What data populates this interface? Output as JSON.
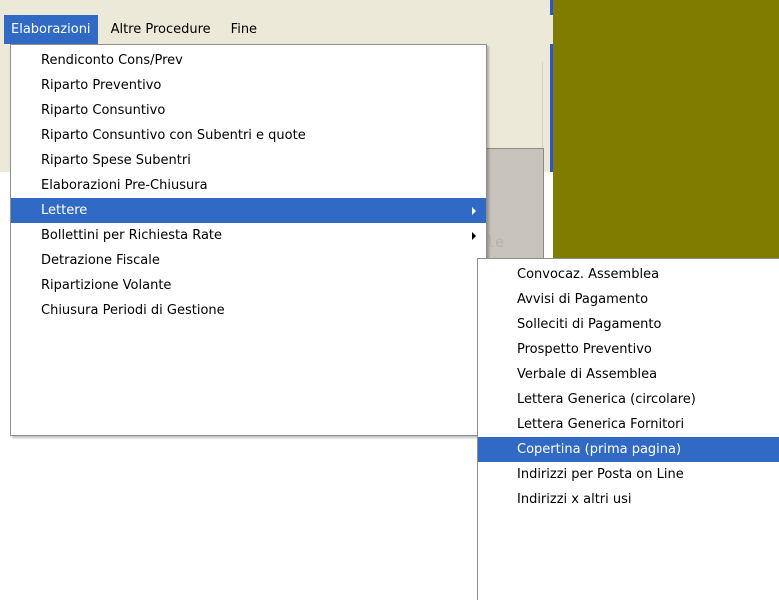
{
  "menubar": {
    "items": [
      "Elaborazioni",
      "Altre Procedure",
      "Fine"
    ]
  },
  "background": {
    "ghost_text": "le",
    "olive_color": "#807c00",
    "highlight_color": "#316ac5"
  },
  "main_menu": {
    "items": [
      {
        "label": "Rendiconto Cons/Prev"
      },
      {
        "label": "Riparto Preventivo"
      },
      {
        "label": "Riparto Consuntivo"
      },
      {
        "label": "Riparto Consuntivo con Subentri e quote"
      },
      {
        "label": "Riparto Spese Subentri"
      },
      {
        "label": "Elaborazioni Pre-Chiusura"
      },
      {
        "label": "Lettere",
        "submenu": true,
        "highlighted": true
      },
      {
        "label": "Bollettini per Richiesta Rate",
        "submenu": true
      },
      {
        "label": "Detrazione Fiscale"
      },
      {
        "label": "Ripartizione Volante"
      },
      {
        "label": "Chiusura Periodi di Gestione"
      }
    ]
  },
  "sub_menu": {
    "items": [
      {
        "label": "Convocaz. Assemblea"
      },
      {
        "label": "Avvisi di Pagamento"
      },
      {
        "label": "Solleciti di Pagamento"
      },
      {
        "label": "Prospetto Preventivo"
      },
      {
        "label": "Verbale di Assemblea"
      },
      {
        "label": "Lettera Generica (circolare)"
      },
      {
        "label": "Lettera Generica Fornitori"
      },
      {
        "label": "Copertina (prima pagina)",
        "highlighted": true
      },
      {
        "label": "Indirizzi per Posta on Line"
      },
      {
        "label": "Indirizzi x altri usi"
      }
    ]
  }
}
